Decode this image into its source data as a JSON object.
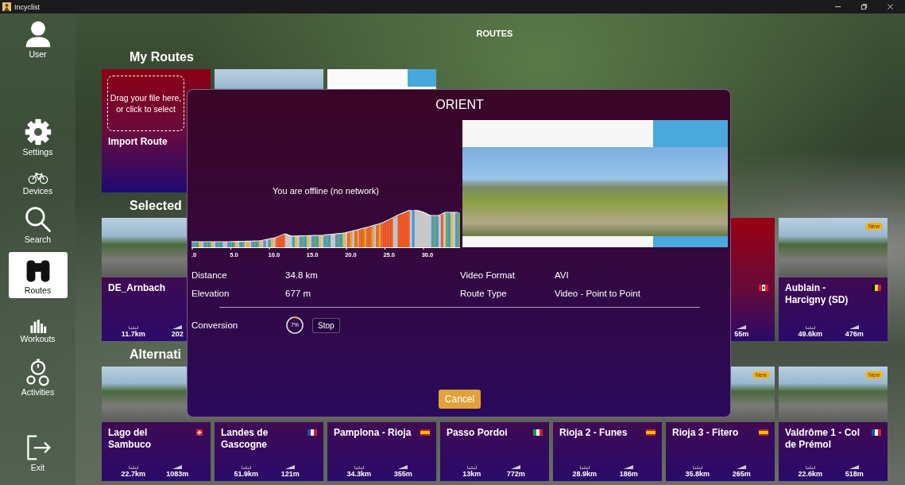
{
  "window": {
    "title": "Incyclist"
  },
  "sidebar": {
    "items": [
      {
        "kind": "user",
        "label": "User",
        "selected": false
      },
      {
        "kind": "settings",
        "label": "Settings",
        "selected": false
      },
      {
        "kind": "devices",
        "label": "Devices",
        "selected": false
      },
      {
        "kind": "search",
        "label": "Search",
        "selected": false
      },
      {
        "kind": "routes",
        "label": "Routes",
        "selected": true
      },
      {
        "kind": "workouts",
        "label": "Workouts",
        "selected": false
      },
      {
        "kind": "activities",
        "label": "Activities",
        "selected": false
      },
      {
        "kind": "exit",
        "label": "Exit",
        "selected": false
      }
    ]
  },
  "page_title": "ROUTES",
  "sections": [
    {
      "heading": "My Routes",
      "cards": [
        {
          "kind": "import",
          "drop_text": "Drag your file here, or click to select",
          "title": "Import Route"
        },
        {
          "kind": "photo"
        },
        {
          "kind": "video"
        }
      ]
    },
    {
      "heading": "Selected",
      "cards": [
        {
          "kind": "photo",
          "title": "DE_Arnbach",
          "distance": "11.7km",
          "elevation": "202"
        },
        {
          "kind": "plain",
          "flag": {
            "kind": "ca"
          },
          "elevation": "55m"
        },
        {
          "kind": "photo",
          "title": "Aublain - Harcigny (SD)",
          "flag": {
            "kind": "be"
          },
          "distance": "49.6km",
          "elevation": "476m",
          "badge": "New"
        }
      ]
    },
    {
      "heading": "Alternati",
      "cards": [
        {
          "kind": "photo",
          "title": "Lago del Sambuco",
          "flag": {
            "kind": "ch"
          },
          "distance": "22.7km",
          "elevation": "1083m"
        },
        {
          "kind": "photo",
          "title": "Landes de Gascogne",
          "flag": {
            "kind": "fr"
          },
          "distance": "51.9km",
          "elevation": "121m"
        },
        {
          "kind": "photo",
          "title": "Pamplona - Rioja",
          "flag": {
            "kind": "es"
          },
          "distance": "34.3km",
          "elevation": "355m"
        },
        {
          "kind": "photo",
          "title": "Passo Pordoi",
          "flag": {
            "kind": "it"
          },
          "distance": "13km",
          "elevation": "772m"
        },
        {
          "kind": "photo",
          "title": "Rioja 2 - Funes",
          "flag": {
            "kind": "es"
          },
          "distance": "28.9km",
          "elevation": "186m"
        },
        {
          "kind": "photo",
          "title": "Rioja 3 - Fitero",
          "flag": {
            "kind": "es"
          },
          "distance": "35.8km",
          "elevation": "265m",
          "badge": "New"
        },
        {
          "kind": "photo",
          "title": "Valdrôme 1 - Col de Prémol",
          "flag": {
            "kind": "fr"
          },
          "distance": "22.6km",
          "elevation": "518m",
          "badge": "New"
        }
      ]
    }
  ],
  "dialog": {
    "title": "ORIENT",
    "offline_message": "You are offline (no network)",
    "profile_ticks": [
      ".0",
      "5.0",
      "10.0",
      "15.0",
      "20.0",
      "25.0",
      "30.0"
    ],
    "details": [
      {
        "label": "Distance",
        "value": "34.8 km"
      },
      {
        "label": "Video Format",
        "value": "AVI"
      },
      {
        "label": "Elevation",
        "value": "677 m"
      },
      {
        "label": "Route Type",
        "value": "Video - Point to Point"
      }
    ],
    "conversion": {
      "label": "Conversion",
      "level": 0.07,
      "percent": "7%",
      "stop_button": "Stop"
    },
    "cancel_button": "Cancel"
  }
}
